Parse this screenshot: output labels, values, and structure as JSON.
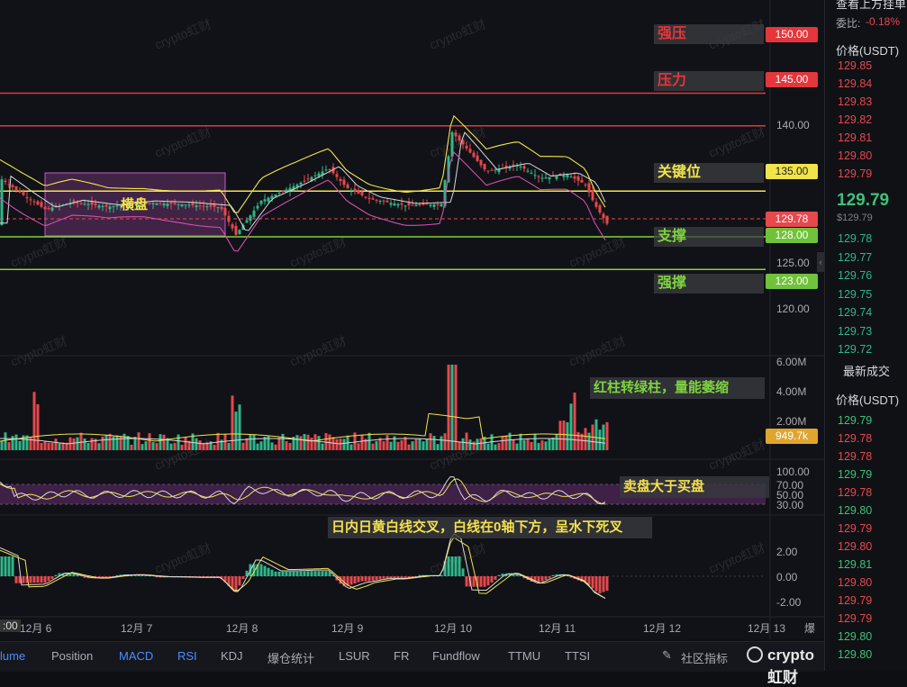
{
  "levels": [
    {
      "name": "强压",
      "price": 150.0,
      "label": "150.00",
      "color": "#e5363b"
    },
    {
      "name": "压力",
      "price": 145.0,
      "label": "145.00",
      "color": "#e5363b"
    },
    {
      "name": "关键位",
      "price": 135.0,
      "label": "135.00",
      "color": "#f1e44a"
    },
    {
      "name": "支撑",
      "price": 128.0,
      "label": "128.00",
      "color": "#7fd33f"
    },
    {
      "name": "强撑",
      "price": 123.0,
      "label": "123.00",
      "color": "#7fd33f"
    }
  ],
  "current_price_label": "129.78",
  "price_axis": [
    "140.00",
    "125.00",
    "120.00"
  ],
  "volume_axis": [
    "6.00M",
    "4.00M",
    "2.00M"
  ],
  "volume_current": "949.7k",
  "rsi_axis": [
    "100.00",
    "70.00",
    "50.00",
    "30.00"
  ],
  "macd_axis": [
    "2.00",
    "0.00",
    "-2.00"
  ],
  "range_label": "横盘",
  "annotations": {
    "volume": "红柱转绿柱，量能萎缩",
    "rsi": "卖盘大于买盘",
    "macd": "日内日黄白线交叉，白线在0轴下方，呈水下死叉"
  },
  "x_ticks": [
    "12月 6",
    "12月 7",
    "12月 8",
    "12月 9",
    "12月 10",
    "12月 11",
    "12月 12",
    "12月 13"
  ],
  "x_time": ":00",
  "x_trailing": "爆",
  "tabs": [
    "lume",
    "Position",
    "MACD",
    "RSI",
    "KDJ",
    "爆仓统计",
    "LSUR",
    "FR",
    "Fundflow",
    "TTMU",
    "TTSI"
  ],
  "community": "社区指标",
  "watermark": "crypto虹财",
  "brand": "crypto虹财",
  "right_panel": {
    "top_title": "查看上方挂单",
    "ratio_label": "委比:",
    "ratio_value": "-0.18%",
    "price_header": "价格(USDT)",
    "ask_prices": [
      "129.85",
      "129.84",
      "129.83",
      "129.82",
      "129.81",
      "129.80",
      "129.79"
    ],
    "last_price": "129.79",
    "last_price_sub": "$129.79",
    "bid_prices": [
      "129.78",
      "129.77",
      "129.76",
      "129.75",
      "129.74",
      "129.73",
      "129.72"
    ],
    "trades_title": "最新成交",
    "trades_header": "价格(USDT)",
    "trades": [
      {
        "p": "129.79",
        "c": "#3ec07a"
      },
      {
        "p": "129.78",
        "c": "#e5484d"
      },
      {
        "p": "129.78",
        "c": "#e5484d"
      },
      {
        "p": "129.79",
        "c": "#3ec07a"
      },
      {
        "p": "129.78",
        "c": "#e5484d"
      },
      {
        "p": "129.80",
        "c": "#3ec07a"
      },
      {
        "p": "129.79",
        "c": "#e5484d"
      },
      {
        "p": "129.80",
        "c": "#e5484d"
      },
      {
        "p": "129.81",
        "c": "#3ec07a"
      },
      {
        "p": "129.80",
        "c": "#e5484d"
      },
      {
        "p": "129.79",
        "c": "#e5484d"
      },
      {
        "p": "129.79",
        "c": "#e5484d"
      },
      {
        "p": "129.80",
        "c": "#3ec07a"
      },
      {
        "p": "129.80",
        "c": "#3ec07a"
      }
    ]
  },
  "colors": {
    "up": "#2fb689",
    "down": "#e5484d",
    "yellow": "#f1e44a",
    "white": "#d8d8d8",
    "pink": "#d24fb0",
    "accent": "#4b8cff"
  }
}
